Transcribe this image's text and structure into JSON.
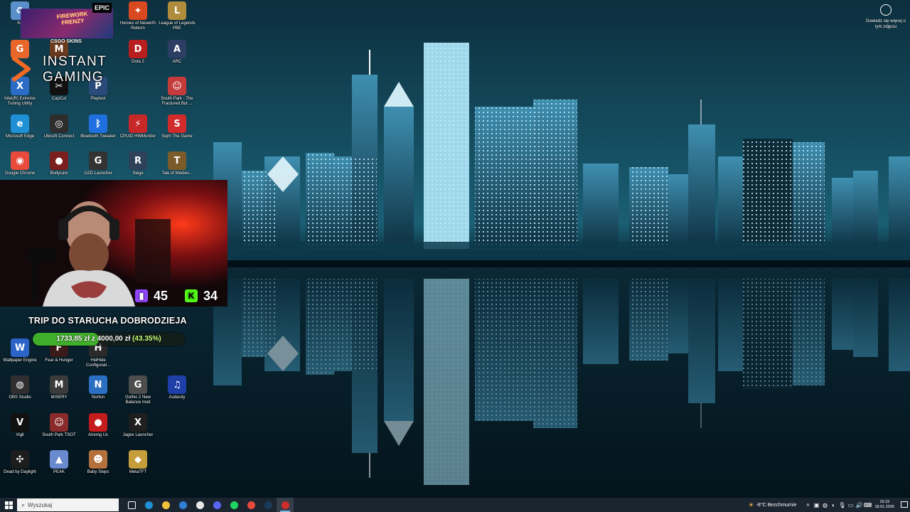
{
  "desktop": {
    "icons": [
      {
        "id": "kosz",
        "label": "Ko",
        "icon": "recycle-bin-icon",
        "color": "#5b8fc9",
        "glyph": "♻"
      },
      {
        "id": "heroes",
        "label": "Heroes of Newerth Reborn",
        "icon": "heroes-of-newerth-icon",
        "color": "#d9491f",
        "glyph": "✦"
      },
      {
        "id": "lol",
        "label": "League of Legends PBE",
        "icon": "league-of-legends-icon",
        "color": "#b08d3c",
        "glyph": "L"
      },
      {
        "id": "g2",
        "label": "",
        "icon": "orange-app-icon",
        "color": "#e8662a",
        "glyph": "G"
      },
      {
        "id": "monk",
        "label": "",
        "icon": "game-icon",
        "color": "#6b3b1f",
        "glyph": "M"
      },
      {
        "id": "dota",
        "label": "Dota 2",
        "icon": "dota-2-icon",
        "color": "#b81e1e",
        "glyph": "D"
      },
      {
        "id": "arc",
        "label": "ARC",
        "icon": "arc-icon",
        "color": "#2c3e64",
        "glyph": "A"
      },
      {
        "id": "intel",
        "label": "Intel(R) Extreme Tuning Utility",
        "icon": "intel-xtu-icon",
        "color": "#2b6cc4",
        "glyph": "X"
      },
      {
        "id": "capcut",
        "label": "CapCut",
        "icon": "capcut-icon",
        "color": "#111111",
        "glyph": "✂"
      },
      {
        "id": "playtest",
        "label": "Playtest",
        "icon": "playtest-icon",
        "color": "#2a4a7a",
        "glyph": "P"
      },
      {
        "id": "southpark",
        "label": "South Park - The Fractured But ...",
        "icon": "south-park-icon",
        "color": "#c43b3b",
        "glyph": "☺"
      },
      {
        "id": "edge",
        "label": "Microsoft Edge",
        "icon": "edge-icon",
        "color": "#1f8fd6",
        "glyph": "e"
      },
      {
        "id": "ubisoft",
        "label": "Ubisoft Connect",
        "icon": "ubisoft-icon",
        "color": "#2d2d2d",
        "glyph": "◎"
      },
      {
        "id": "bt",
        "label": "Bluetooth Tweaker",
        "icon": "bluetooth-icon",
        "color": "#1f6fe0",
        "glyph": "ᛒ"
      },
      {
        "id": "cpuid",
        "label": "CPUID HWMonitor",
        "icon": "cpuid-icon",
        "color": "#c62828",
        "glyph": "⚡"
      },
      {
        "id": "sejm",
        "label": "Sejm The Game",
        "icon": "sejm-game-icon",
        "color": "#d12b2b",
        "glyph": "S"
      },
      {
        "id": "chrome",
        "label": "Google Chrome",
        "icon": "chrome-icon",
        "color": "#e84b3c",
        "glyph": "◉"
      },
      {
        "id": "bodycam",
        "label": "Bodycam",
        "icon": "bodycam-icon",
        "color": "#7a1e1e",
        "glyph": "●"
      },
      {
        "id": "gzd",
        "label": "GZD Launcher",
        "icon": "gzd-launcher-icon",
        "color": "#333333",
        "glyph": "G"
      },
      {
        "id": "siege",
        "label": "Siege",
        "icon": "siege-icon",
        "color": "#2d4258",
        "glyph": "R"
      },
      {
        "id": "tome",
        "label": "Tale of Mediev...",
        "icon": "tome-icon",
        "color": "#7b5b2a",
        "glyph": "T"
      },
      {
        "id": "wallpaper",
        "label": "Wallpaper Engine",
        "icon": "wallpaper-engine-icon",
        "color": "#2b63c7",
        "glyph": "W"
      },
      {
        "id": "fear",
        "label": "Fear & Hunger",
        "icon": "fear-hunger-icon",
        "color": "#3a1a1a",
        "glyph": "F"
      },
      {
        "id": "hidehide",
        "label": "HidHide Configurati...",
        "icon": "hidhide-icon",
        "color": "#2a2a2a",
        "glyph": "H"
      },
      {
        "id": "obs",
        "label": "OBS Studio",
        "icon": "obs-icon",
        "color": "#302e31",
        "glyph": "◍"
      },
      {
        "id": "misery",
        "label": "MISERY",
        "icon": "misery-icon",
        "color": "#3b3b3b",
        "glyph": "M"
      },
      {
        "id": "norton",
        "label": "Norton",
        "icon": "norton-icon",
        "color": "#2a6fc2",
        "glyph": "N"
      },
      {
        "id": "gothic",
        "label": "Gothic 2 New Balance mod",
        "icon": "gothic-icon",
        "color": "#4d4d4d",
        "glyph": "G"
      },
      {
        "id": "audacity",
        "label": "Audacity",
        "icon": "audacity-icon",
        "color": "#1f3fa8",
        "glyph": "♫"
      },
      {
        "id": "vigil",
        "label": "Vigil",
        "icon": "vigil-icon",
        "color": "#111111",
        "glyph": "V"
      },
      {
        "id": "sptsot",
        "label": "South Park TSOT",
        "icon": "south-park-tsot-icon",
        "color": "#8a2b2b",
        "glyph": "☺"
      },
      {
        "id": "amongus",
        "label": "Among Us",
        "icon": "among-us-icon",
        "color": "#c41c1c",
        "glyph": "●"
      },
      {
        "id": "jagex",
        "label": "Jagex Launcher",
        "icon": "jagex-icon",
        "color": "#1f1f1f",
        "glyph": "X"
      },
      {
        "id": "dbd",
        "label": "Dead by Daylight",
        "icon": "dead-by-daylight-icon",
        "color": "#1d1d1d",
        "glyph": "✣"
      },
      {
        "id": "peak",
        "label": "PEAK",
        "icon": "peak-icon",
        "color": "#6a8ad0",
        "glyph": "▲"
      },
      {
        "id": "babysteps",
        "label": "Baby Steps",
        "icon": "baby-steps-icon",
        "color": "#b5713b",
        "glyph": "☻"
      },
      {
        "id": "metatft",
        "label": "MetaTFT",
        "icon": "metatft-icon",
        "color": "#c59d3a",
        "glyph": "◆"
      }
    ]
  },
  "overlay": {
    "firework_title": "FIREWORK FRENZY",
    "epic_label": "EPIC",
    "csgo_label": "CSGO SKINS",
    "brand_line1": "INSTANT",
    "brand_line2": "GAMING",
    "twitch_count": "45",
    "kick_count": "34",
    "goal_title": "TRIP DO STARUCHA DOBRODZIEJA",
    "goal_amount": "1733,85 zł",
    "goal_of": "z",
    "goal_target": "4000,00 zł",
    "goal_percent_text": "(43.35%)",
    "goal_progress": 0.4335
  },
  "learn_more": {
    "label": "Dowiedz się więcej o tym zdjęciu",
    "icon": "camera-icon"
  },
  "taskbar": {
    "search_placeholder": "Wyszukaj",
    "apps": [
      {
        "name": "task-view-icon",
        "color": "#ffffff"
      },
      {
        "name": "edge-icon",
        "color": "#1f8fd6"
      },
      {
        "name": "file-explorer-icon",
        "color": "#f0c23b"
      },
      {
        "name": "mail-icon",
        "color": "#2f7fd8"
      },
      {
        "name": "store-icon",
        "color": "#e9e9e9"
      },
      {
        "name": "discord-icon",
        "color": "#5865f2"
      },
      {
        "name": "spotify-icon",
        "color": "#1ed760"
      },
      {
        "name": "chrome-icon",
        "color": "#e84b3c"
      },
      {
        "name": "steam-icon",
        "color": "#1b3a5a"
      },
      {
        "name": "obs-icon",
        "color": "#d02c2c"
      }
    ],
    "weather_text": "-8°C Bezchmurnie",
    "time": "19:19",
    "date": "18.01.2026"
  },
  "colors": {
    "taskbar_bg": "#1b2530",
    "goal_fill": "#3fae2a",
    "sky": "#0f3a4a",
    "water": "#06202c"
  }
}
